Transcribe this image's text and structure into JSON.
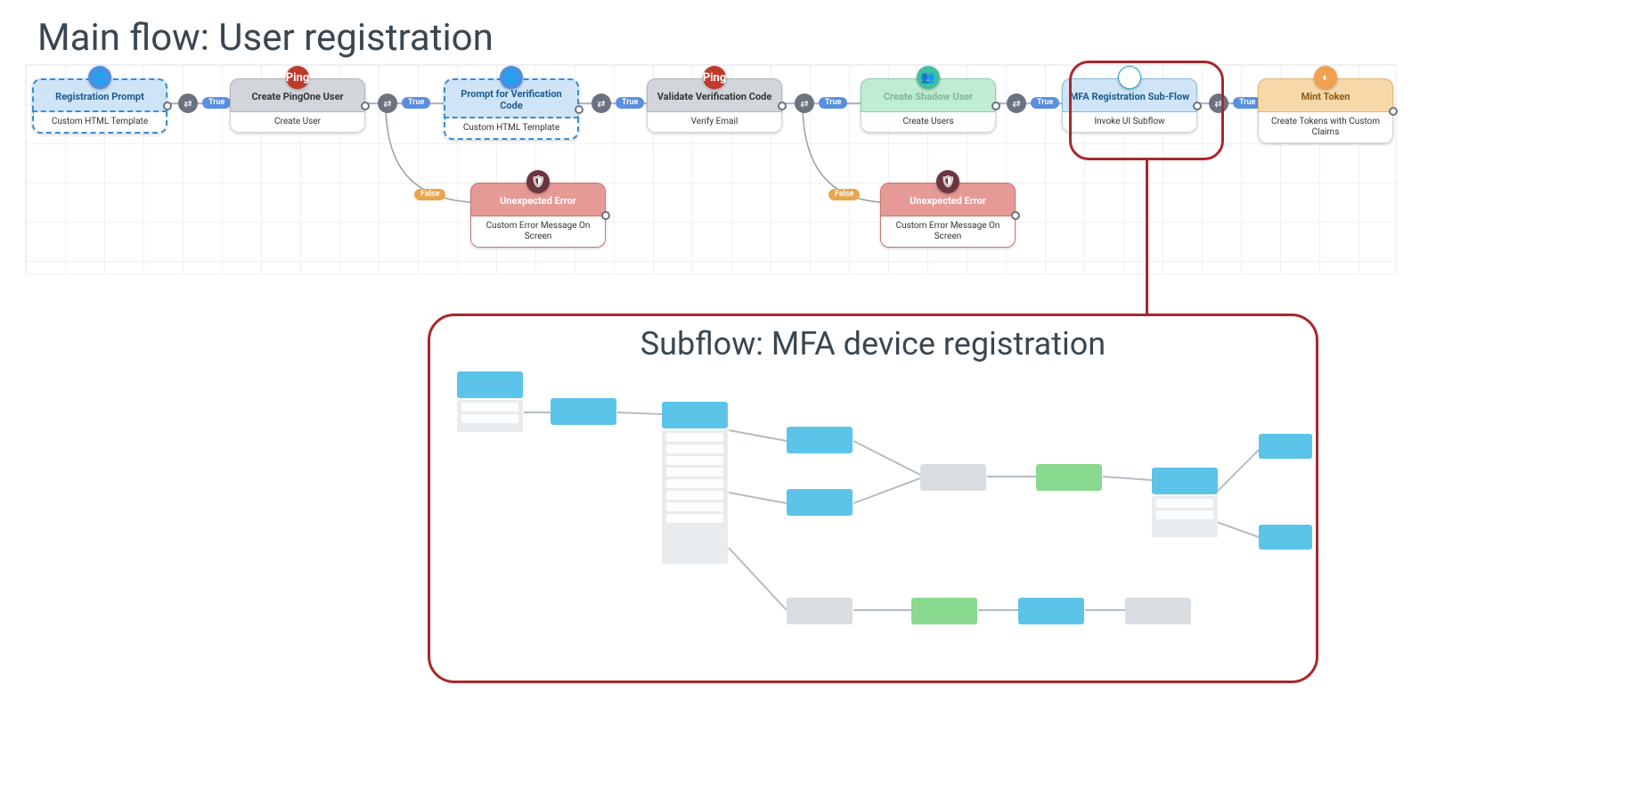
{
  "titles": {
    "main": "Main flow: User registration",
    "sub": "Subflow: MFA device registration"
  },
  "labels": {
    "true": "True",
    "false": "False"
  },
  "icons": {
    "globe": "🌐",
    "ping": "Ping",
    "users": "👥",
    "flow": "⇆",
    "token": "◐",
    "shield": "🛡"
  },
  "nodes": {
    "reg_prompt": {
      "title": "Registration Prompt",
      "subtitle": "Custom HTML Template"
    },
    "create_ping": {
      "title": "Create PingOne User",
      "subtitle": "Create User"
    },
    "prompt_code": {
      "title": "Prompt for Verification Code",
      "subtitle": "Custom HTML Template"
    },
    "validate_code": {
      "title": "Validate Verification Code",
      "subtitle": "Verify Email"
    },
    "shadow_user": {
      "title": "Create Shadow User",
      "subtitle": "Create Users"
    },
    "mfa_subflow": {
      "title": "MFA Registration Sub-Flow",
      "subtitle": "Invoke UI Subflow"
    },
    "mint_token": {
      "title": "Mint Token",
      "subtitle": "Create Tokens with Custom Claims"
    },
    "error1": {
      "title": "Unexpected Error",
      "subtitle": "Custom Error Message On Screen"
    },
    "error2": {
      "title": "Unexpected Error",
      "subtitle": "Custom Error Message On Screen"
    }
  }
}
